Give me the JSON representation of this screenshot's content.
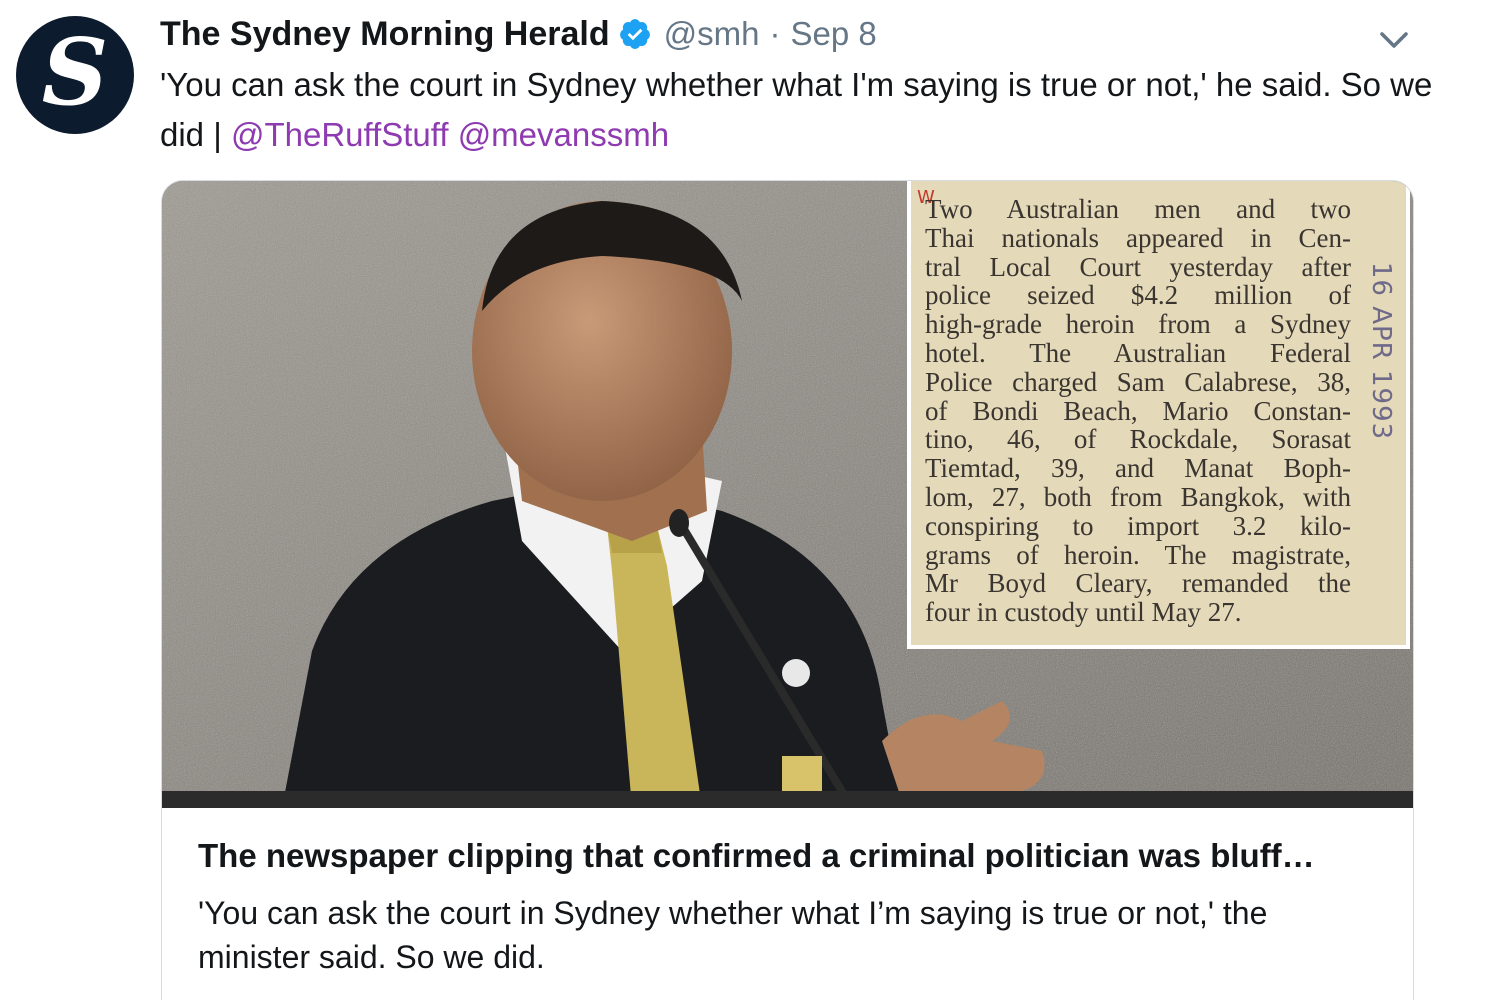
{
  "tweet": {
    "author": {
      "avatar_letter": "S",
      "display_name": "The Sydney Morning Herald",
      "verified": true,
      "handle": "@smh",
      "separator": "·",
      "date": "Sep 8"
    },
    "text": "'You can ask the court in Sydney whether what I'm saying is true or not,' he said. So we did | ",
    "mentions": [
      "@TheRuffStuff",
      "@mevanssmh"
    ],
    "menu_icon": "chevron-down-icon"
  },
  "card": {
    "clipping": {
      "lines": [
        "Two Australian men and two",
        "Thai nationals appeared in Cen-",
        "tral Local Court yesterday after",
        "police seized $4.2 million of",
        "high-grade heroin from a Sydney",
        "hotel. The Australian Federal",
        "Police charged Sam Calabrese, 38,",
        "of Bondi Beach, Mario Constan-",
        "tino, 46, of Rockdale, Sorasat",
        "Tiemtad, 39, and Manat Boph-",
        "lom, 27, both from Bangkok, with",
        "conspiring to import 3.2 kilo-",
        "grams of heroin. The magistrate,",
        "Mr Boyd Cleary, remanded the",
        "four in custody until May 27."
      ],
      "date_stamp": "16 APR 1993",
      "corner_mark": "W"
    },
    "title": "The newspaper clipping that confirmed a criminal politician was bluff…",
    "description": "'You can ask the court in Sydney whether what I’m saying is true or not,' the minister said. So we did."
  },
  "colors": {
    "text": "#14171a",
    "secondary": "#657786",
    "mention": "#8e3ab0",
    "verified": "#1da1f2",
    "avatar_bg": "#0d1b2e",
    "card_border": "#d6dce1",
    "clipping_paper": "#e4d9b8"
  }
}
